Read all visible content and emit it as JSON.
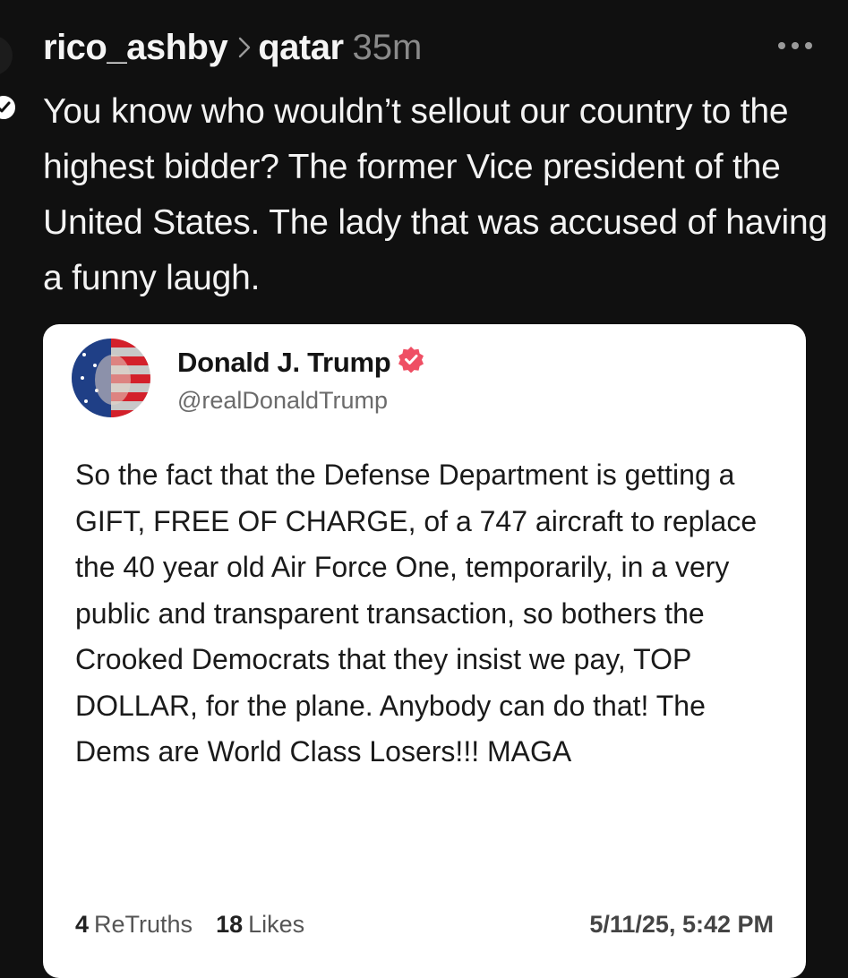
{
  "post": {
    "username": "rico_ashby",
    "community": "qatar",
    "time": "35m",
    "text": "You know who wouldn’t sellout our country to the highest bidder? The former Vice president of the United States. The lady that was accused of having a funny laugh."
  },
  "embedded": {
    "name": "Donald J. Trump",
    "handle": "@realDonaldTrump",
    "body": "So the fact that the Defense Department is getting a GIFT, FREE OF CHARGE, of a 747 aircraft to replace the 40 year old Air Force One, temporarily, in a very public and transparent transaction, so bothers the Crooked Democrats that they insist we pay, TOP DOLLAR, for the plane. Anybody can do that! The Dems are World Class Losers!!! MAGA",
    "retruths_count": "4",
    "retruths_label": "ReTruths",
    "likes_count": "18",
    "likes_label": "Likes",
    "timestamp": "5/11/25, 5:42 PM"
  },
  "icons": {
    "more": "more-horizontal-icon",
    "chevron": "chevron-right-icon",
    "verified": "verified-badge-icon",
    "follow": "follow-check-icon"
  },
  "colors": {
    "background": "#101010",
    "verified": "#ef4f64",
    "card": "#ffffff"
  }
}
